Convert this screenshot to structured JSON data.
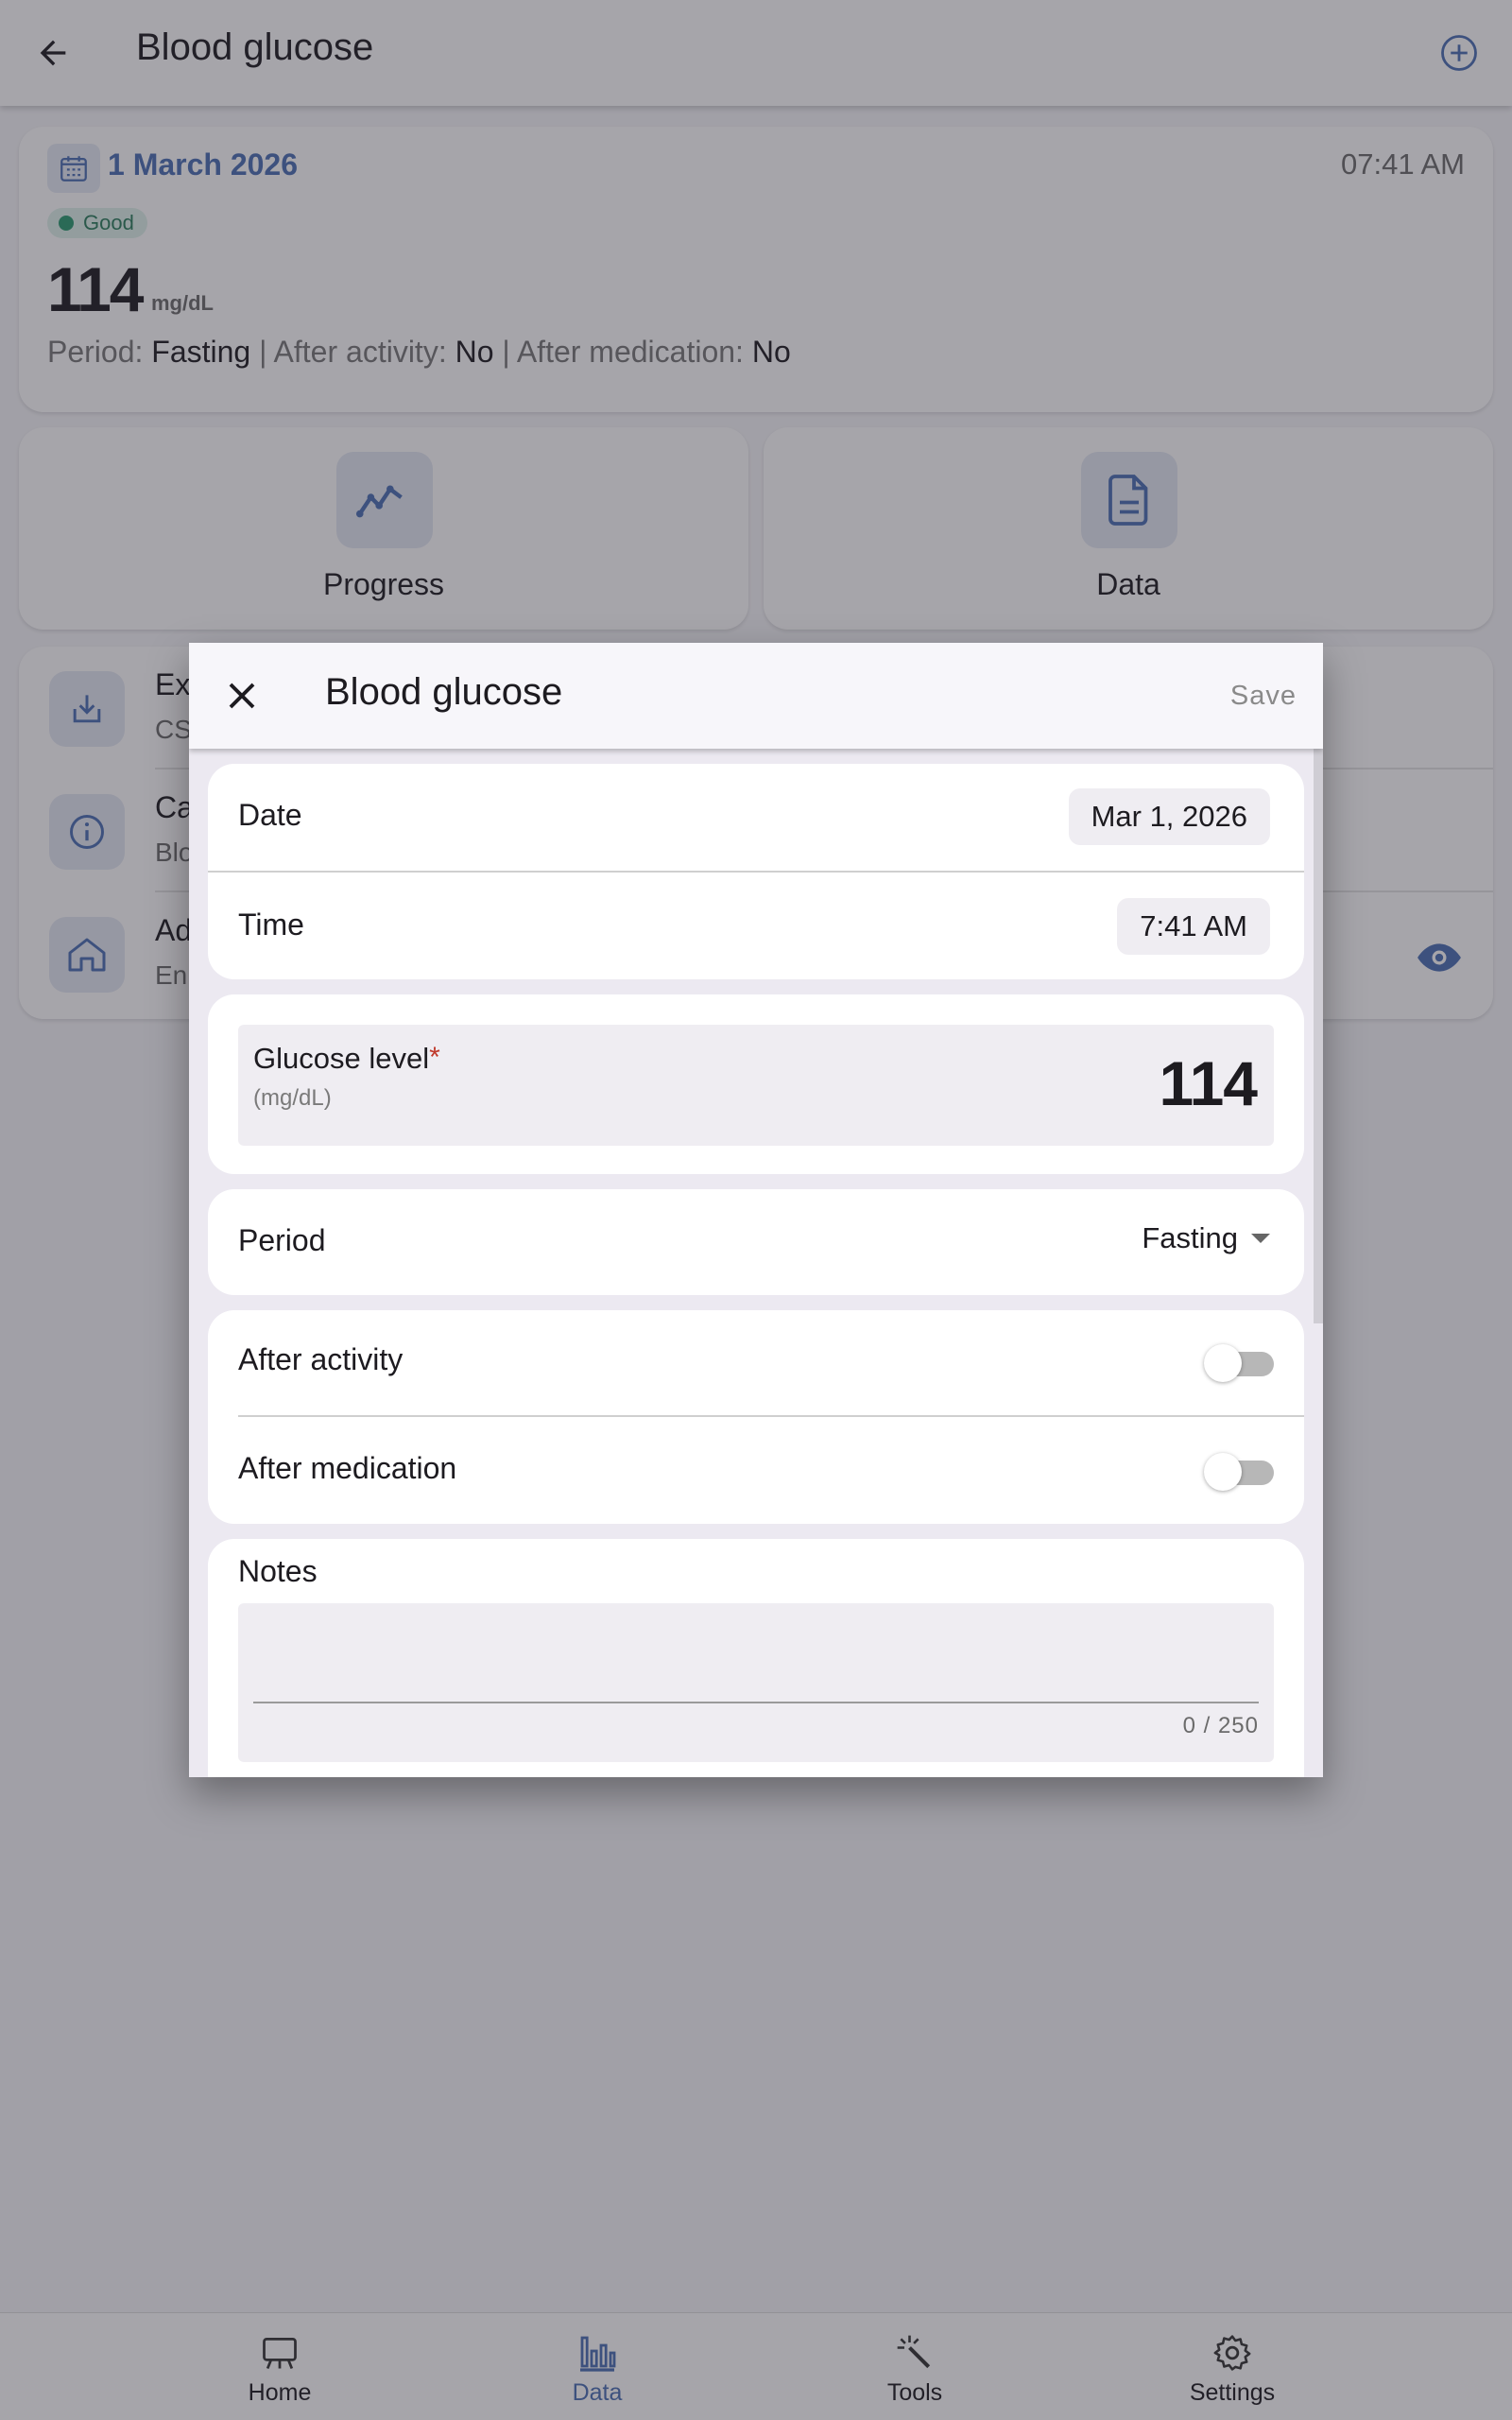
{
  "appbar": {
    "title": "Blood glucose"
  },
  "entry": {
    "date": "1 March 2026",
    "time": "07:41 AM",
    "status": "Good",
    "value": "114",
    "unit": "mg/dL",
    "period_label": "Period:",
    "period_value": "Fasting",
    "sep": "|",
    "activity_label": "After activity:",
    "activity_value": "No",
    "medication_label": "After medication:",
    "medication_value": "No"
  },
  "actions": [
    {
      "label": "Progress",
      "icon": "line-chart-icon"
    },
    {
      "label": "Data",
      "icon": "document-icon"
    }
  ],
  "list": [
    {
      "title": "Ex",
      "subtitle": "CS",
      "icon": "download-icon"
    },
    {
      "title": "Ca",
      "subtitle": "Blo",
      "icon": "info-icon"
    },
    {
      "title": "Ad",
      "subtitle": "En",
      "icon": "home-icon"
    }
  ],
  "nav": [
    {
      "label": "Home",
      "icon": "home-board-icon"
    },
    {
      "label": "Data",
      "icon": "bar-chart-icon"
    },
    {
      "label": "Tools",
      "icon": "magic-wand-icon"
    },
    {
      "label": "Settings",
      "icon": "gear-icon"
    }
  ],
  "dialog": {
    "title": "Blood glucose",
    "save": "Save",
    "date_label": "Date",
    "date_value": "Mar 1, 2026",
    "time_label": "Time",
    "time_value": "7:41 AM",
    "glucose_label": "Glucose level",
    "required_mark": "*",
    "glucose_unit": "(mg/dL)",
    "glucose_value": "114",
    "period_label": "Period",
    "period_value": "Fasting",
    "after_activity_label": "After activity",
    "after_activity_on": false,
    "after_medication_label": "After medication",
    "after_medication_on": false,
    "notes_label": "Notes",
    "notes_counter": "0 / 250"
  },
  "colors": {
    "accent": "#4a6fb3",
    "good": "#2a9a6f",
    "required": "#c0392b"
  }
}
